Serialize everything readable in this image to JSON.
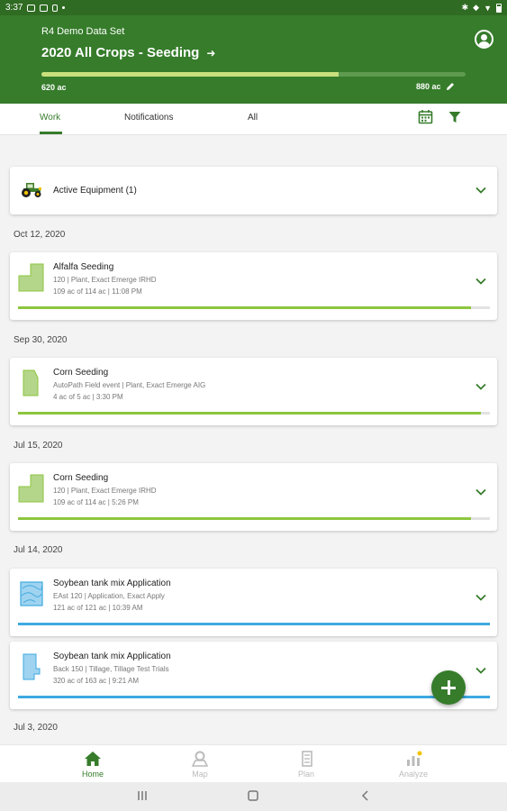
{
  "status_bar": {
    "time": "3:37"
  },
  "header": {
    "dataset": "R4 Demo Data Set",
    "title": "2020 All Crops - Seeding",
    "progress": 0.7,
    "completed_ac": "620 ac",
    "total_ac": "880 ac"
  },
  "tabs": {
    "work": "Work",
    "notifications": "Notifications",
    "all": "All"
  },
  "active_equipment": {
    "label": "Active Equipment (1)"
  },
  "groups": [
    {
      "date": "Oct 12, 2020",
      "operations": [
        {
          "name": "Alfalfa Seeding",
          "detail": "120 | Plant, Exact Emerge IRHD",
          "progress_text": "109 ac of 114 ac | 11:08 PM",
          "progress": 0.96,
          "color": "#8dc63f"
        }
      ]
    },
    {
      "date": "Sep 30, 2020",
      "operations": [
        {
          "name": "Corn Seeding",
          "detail": "AutoPath Field event | Plant, Exact Emerge AIG",
          "progress_text": "4 ac of 5 ac | 3:30 PM",
          "progress": 0.98,
          "color": "#8dc63f"
        }
      ]
    },
    {
      "date": "Jul 15, 2020",
      "operations": [
        {
          "name": "Corn Seeding",
          "detail": "120 | Plant, Exact Emerge IRHD",
          "progress_text": "109 ac of 114 ac | 5:26 PM",
          "progress": 0.96,
          "color": "#8dc63f"
        }
      ]
    },
    {
      "date": "Jul 14, 2020",
      "operations": [
        {
          "name": "Soybean tank mix Application",
          "detail": "EAst 120 | Application, Exact Apply",
          "progress_text": "121 ac of 121 ac | 10:39 AM",
          "progress": 1.0,
          "color": "#3ea9e0"
        },
        {
          "name": "Soybean tank mix Application",
          "detail": "Back 150 | Tillage, Tillage Test Trials",
          "progress_text": "320 ac of 163 ac | 9:21 AM",
          "progress": 1.0,
          "color": "#3ea9e0"
        }
      ]
    },
    {
      "date": "Jul 3, 2020",
      "operations": []
    }
  ],
  "bottom_nav": {
    "home": "Home",
    "map": "Map",
    "plan": "Plan",
    "analyze": "Analyze"
  },
  "colors": {
    "brand_green": "#367c2b",
    "dark_green": "#2f6b22",
    "seeding_green": "#8dc63f",
    "application_blue": "#3ea9e0",
    "progress_fill": "#c9e07d"
  }
}
